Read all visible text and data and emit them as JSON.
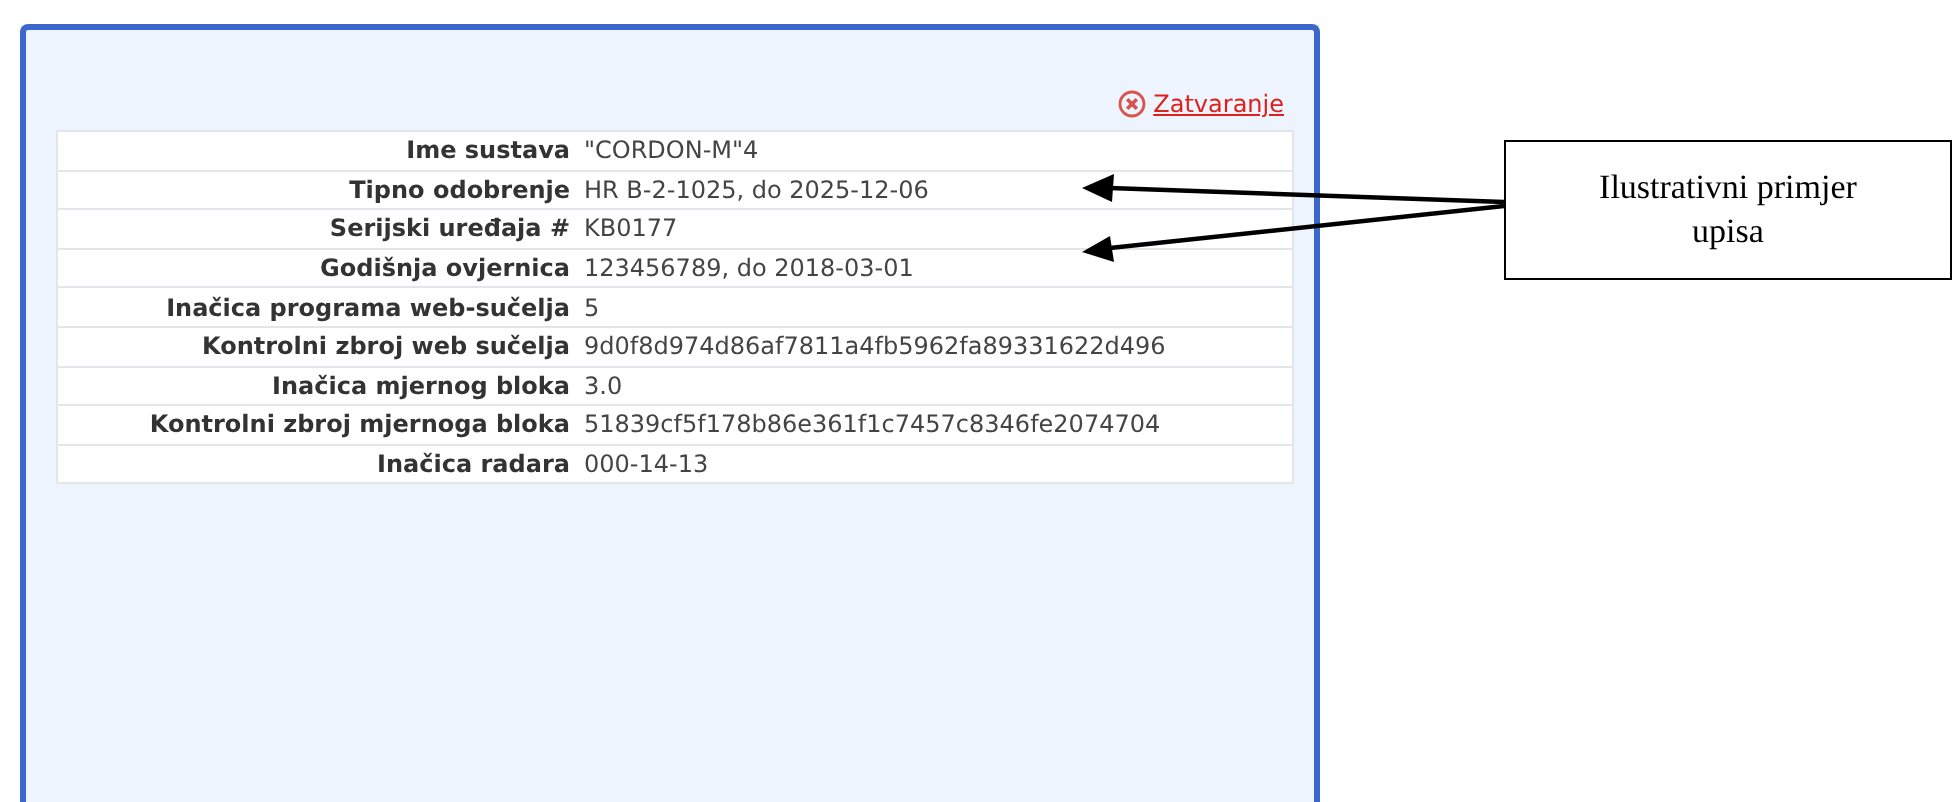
{
  "dialog": {
    "close_link": "Zatvaranje",
    "rows": [
      {
        "label": "Ime sustava",
        "value": "\"CORDON-M\"4"
      },
      {
        "label": "Tipno odobrenje",
        "value": "HR B-2-1025, do 2025-12-06"
      },
      {
        "label": "Serijski uređaja #",
        "value": "KB0177"
      },
      {
        "label": "Godišnja ovjernica",
        "value": "123456789, do 2018-03-01"
      },
      {
        "label": "Inačica programa web-sučelja",
        "value": "5"
      },
      {
        "label": "Kontrolni zbroj web sučelja",
        "value": "9d0f8d974d86af7811a4fb5962fa89331622d496"
      },
      {
        "label": "Inačica mjernog bloka",
        "value": "3.0"
      },
      {
        "label": "Kontrolni zbroj mjernoga bloka",
        "value": "51839cf5f178b86e361f1c7457c8346fe2074704"
      },
      {
        "label": "Inačica radara",
        "value": "000-14-13"
      }
    ]
  },
  "callout": {
    "text": "Ilustrativni primjer upisa"
  }
}
